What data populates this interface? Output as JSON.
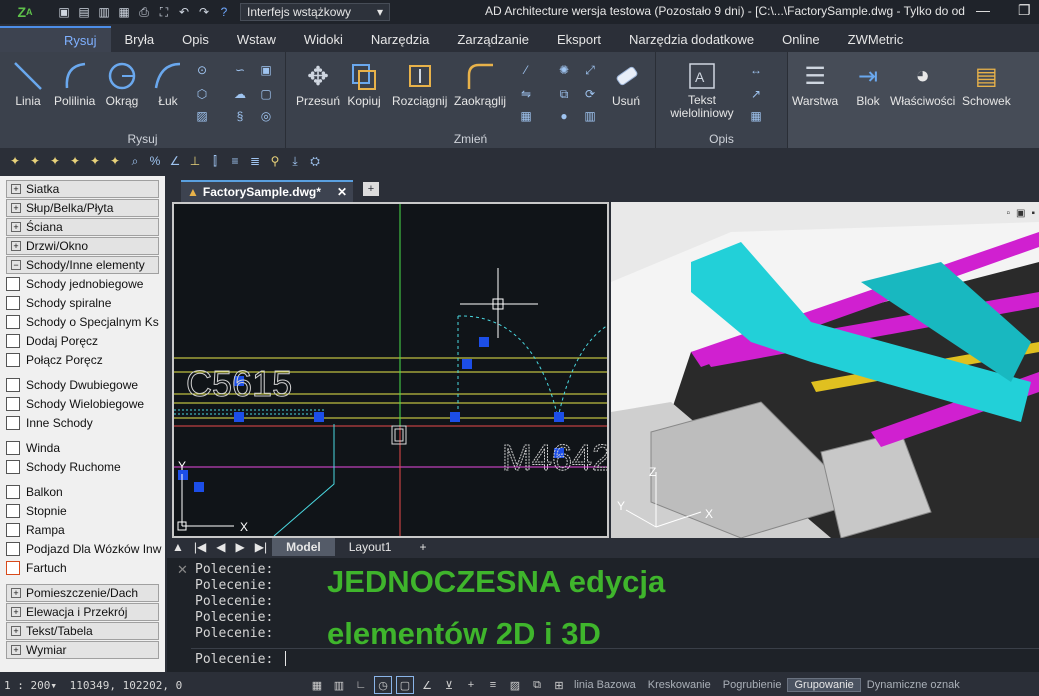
{
  "titlebar": {
    "interface_label": "Interfejs wstążkowy",
    "title": "AD Architecture wersja testowa (Pozostało 9 dni) - [C:\\...\\FactorySample.dwg - Tylko do odc",
    "minimize": "—",
    "restore": "❐"
  },
  "menu": [
    "Rysuj",
    "Bryła",
    "Opis",
    "Wstaw",
    "Widoki",
    "Narzędzia",
    "Zarządzanie",
    "Eksport",
    "Narzędzia dodatkowe",
    "Online",
    "ZWMetric"
  ],
  "ribbon": {
    "draw": {
      "label": "Rysuj",
      "buttons": [
        "Linia",
        "Polilinia",
        "Okrąg",
        "Łuk"
      ]
    },
    "modify": {
      "label": "Zmień",
      "buttons": [
        "Przesuń",
        "Kopiuj",
        "Rozciągnij",
        "Zaokrąglij",
        "Usuń"
      ]
    },
    "annotate": {
      "label": "Opis",
      "buttons": [
        "Tekst wieloliniowy"
      ]
    },
    "extra": [
      "Warstwa",
      "Blok",
      "Właściwości",
      "Schowek"
    ]
  },
  "left_panel": {
    "headers_top": [
      "Siatka",
      "Słup/Belka/Płyta",
      "Ściana",
      "Drzwi/Okno",
      "Schody/Inne elementy"
    ],
    "group1": [
      "Schody jednobiegowe",
      "Schody spiralne",
      "Schody o Specjalnym Ks",
      "Dodaj Poręcz",
      "Połącz Poręcz"
    ],
    "group2": [
      "Schody Dwubiegowe",
      "Schody Wielobiegowe",
      "Inne Schody"
    ],
    "group3": [
      "Winda",
      "Schody Ruchome"
    ],
    "group4": [
      "Balkon",
      "Stopnie",
      "Rampa",
      "Podjazd Dla Wózków Inw",
      "Fartuch"
    ],
    "headers_bottom": [
      "Pomieszczenie/Dach",
      "Elewacja i Przekrój",
      "Tekst/Tabela",
      "Wymiar"
    ]
  },
  "document_tab": {
    "name": "FactorySample.dwg*"
  },
  "drawing": {
    "label1": "C5615",
    "label2": "M4642",
    "axis_x": "X",
    "axis_y": "Y",
    "axis_z": "Z"
  },
  "layout_tabs": [
    "Model",
    "Layout1",
    "+"
  ],
  "command": {
    "history": [
      "Polecenie:",
      "Polecenie:",
      "Polecenie:",
      "Polecenie:",
      "Polecenie:"
    ],
    "prompt": "Polecenie:"
  },
  "promo": {
    "line1": "JEDNOCZESNA edycja",
    "line2": "elementów 2D i 3D"
  },
  "status": {
    "scale": "1 : 200▾",
    "coords": "110349, 102202, 0",
    "toggles": [
      "linia Bazowa",
      "Kreskowanie",
      "Pogrubienie",
      "Grupowanie",
      "Dynamiczne oznak"
    ]
  }
}
